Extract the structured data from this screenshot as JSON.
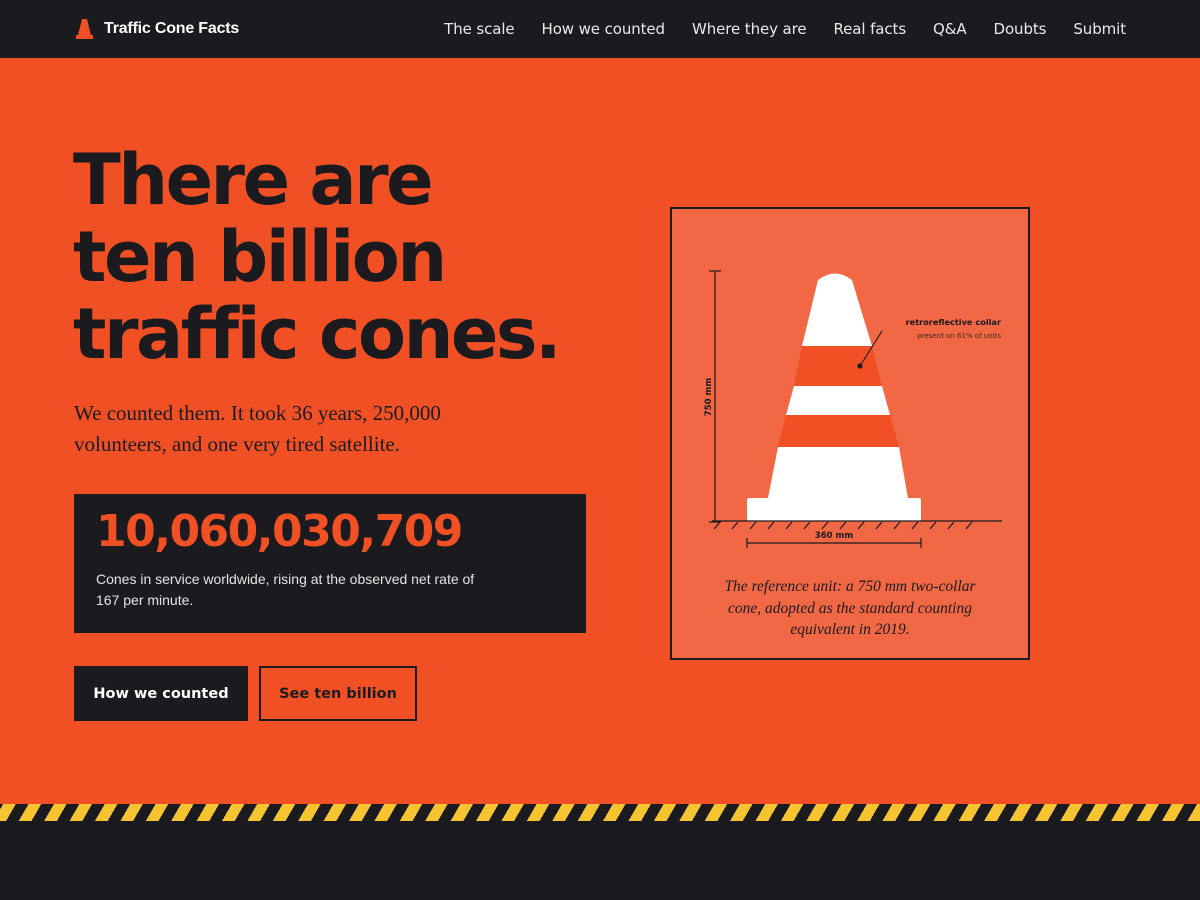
{
  "brand": {
    "name": "Traffic Cone Facts",
    "icon": "traffic-cone-icon",
    "color": "#f05023"
  },
  "nav": {
    "links": [
      "The scale",
      "How we counted",
      "Where they are",
      "Real facts",
      "Q&A",
      "Doubts",
      "Submit"
    ]
  },
  "hero": {
    "headline_lines": [
      "There are",
      "ten billion",
      "traffic cones."
    ],
    "subtitle": "We counted them. It took 36 years, 250,000 volunteers, and one very tired satellite.",
    "counter": {
      "value": "10,060,030,709",
      "description": "Cones in service worldwide, rising at the observed net rate of 167 per minute."
    },
    "buttons": {
      "primary": "How we counted",
      "secondary": "See ten billion"
    }
  },
  "figure": {
    "height_label": "750 mm",
    "width_label": "360 mm",
    "annotation_title": "retroreflective collar",
    "annotation_note": "present on 61% of units",
    "caption": "The reference unit: a 750 mm two-collar cone, adopted as the standard counting equivalent in 2019."
  },
  "colors": {
    "accent": "#f05023",
    "dark": "#1b1b1f",
    "figure_bg": "#f26744",
    "hazard_yellow": "#f6c431"
  }
}
